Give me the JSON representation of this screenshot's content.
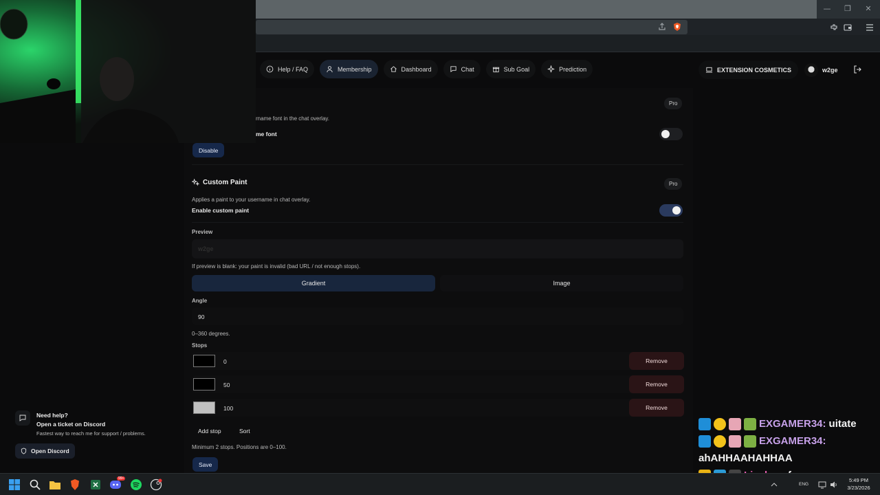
{
  "nav": {
    "items": [
      {
        "label": "Help / FAQ",
        "icon": "info-icon",
        "active": false
      },
      {
        "label": "Membership",
        "icon": "person-icon",
        "active": true
      },
      {
        "label": "Dashboard",
        "icon": "home-icon",
        "active": false
      },
      {
        "label": "Chat",
        "icon": "chat-icon",
        "active": false
      },
      {
        "label": "Sub Goal",
        "icon": "gift-icon",
        "active": false
      },
      {
        "label": "Prediction",
        "icon": "sparkle-icon",
        "active": false
      }
    ],
    "extension_label": "EXTENSION COSMETICS",
    "username": "w2ge"
  },
  "font_section": {
    "badge": "Pro",
    "desc": "rname font in the chat overlay.",
    "toggle_label": "me font",
    "toggle_on": false,
    "disable_label": "Disable"
  },
  "paint_section": {
    "title": "Custom Paint",
    "badge": "Pro",
    "desc": "Applies a paint to your username in chat overlay.",
    "toggle_label": "Enable custom paint",
    "toggle_on": true,
    "preview_label": "Preview",
    "preview_text": "w2ge",
    "preview_hint": "If preview is blank: your paint is invalid (bad URL / not enough stops).",
    "mode_gradient": "Gradient",
    "mode_image": "Image",
    "angle_label": "Angle",
    "angle_value": "90",
    "angle_hint": "0–360 degrees.",
    "stops_label": "Stops",
    "stops": [
      {
        "position": "0",
        "color": "#000000",
        "remove": "Remove"
      },
      {
        "position": "50",
        "color": "#000000",
        "remove": "Remove"
      },
      {
        "position": "100",
        "color": "#c0c0c0",
        "remove": "Remove"
      }
    ],
    "add_stop": "Add stop",
    "sort": "Sort",
    "stops_hint": "Minimum 2 stops. Positions are 0–100.",
    "save": "Save"
  },
  "help": {
    "title": "Need help?",
    "subtitle": "Open a ticket on Discord",
    "desc": "Fastest way to reach me for support / problems.",
    "button": "Open Discord"
  },
  "chat_overlay": {
    "lines": [
      {
        "user": "EXGAMER34:",
        "message": "uitate"
      },
      {
        "user": "EXGAMER34:",
        "message": "ahAHHAAHAHHAA"
      },
      {
        "user": "Lizukaa:",
        "message": "fmm"
      }
    ]
  },
  "taskbar": {
    "time": "5:49 PM",
    "date": "3/23/2026",
    "lang": "ENG",
    "discord_badge": "99+"
  },
  "colors": {
    "accent_blue": "#16284a",
    "remove_red": "#2a1416",
    "chat_name": "#c6a0e8"
  }
}
